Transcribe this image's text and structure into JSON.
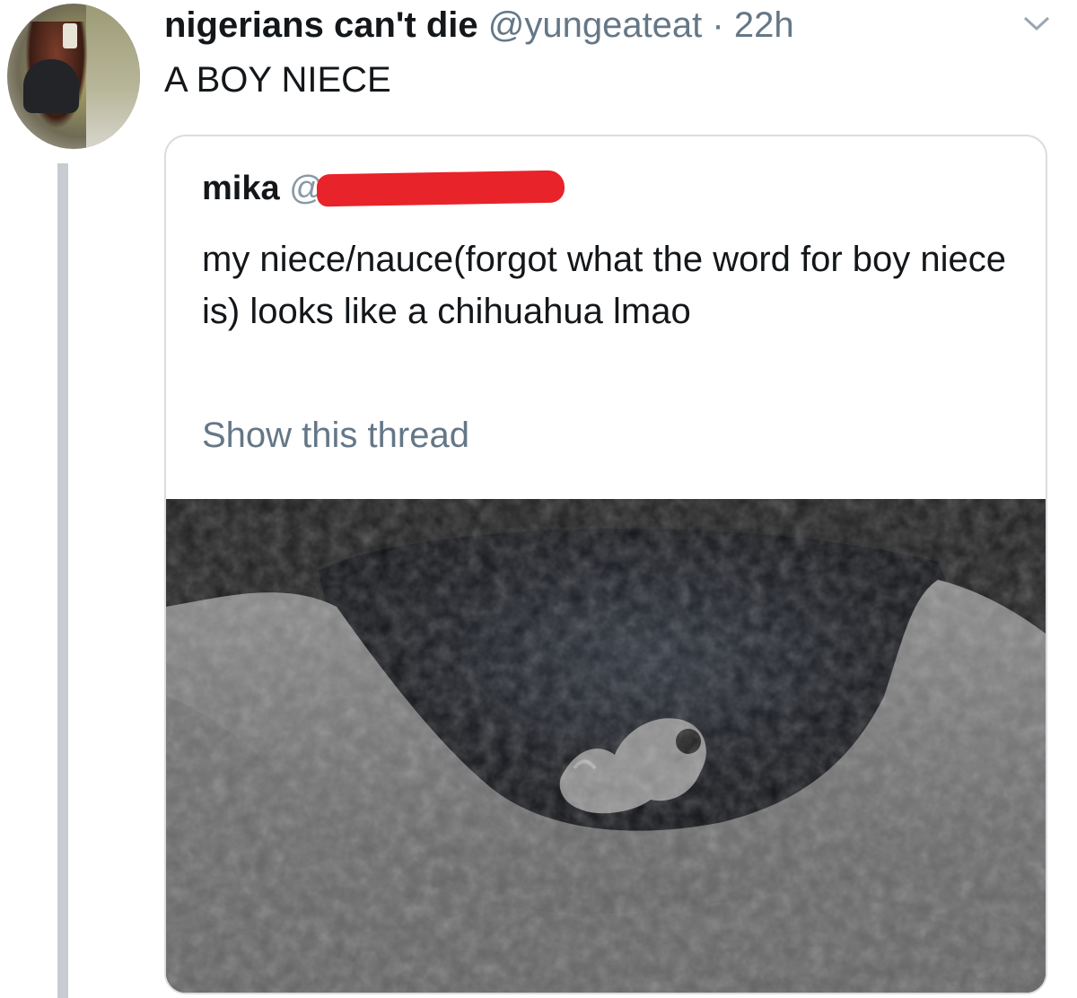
{
  "tweet": {
    "author_name": "nigerians can't die",
    "author_handle": "@yungeateat",
    "separator": "·",
    "time": "22h",
    "text": "A BOY NIECE"
  },
  "quoted": {
    "author_name": "mika",
    "author_handle_visible": "@",
    "text": "my niece/nauce(forgot what the word for boy niece is) looks like a chihuahua lmao",
    "show_thread": "Show this thread",
    "media": "ultrasound image"
  },
  "colors": {
    "text": "#14171a",
    "secondary": "#657786",
    "border": "#d9dde2",
    "redaction": "#e8232a"
  },
  "icons": [
    "chevron-down-icon"
  ]
}
